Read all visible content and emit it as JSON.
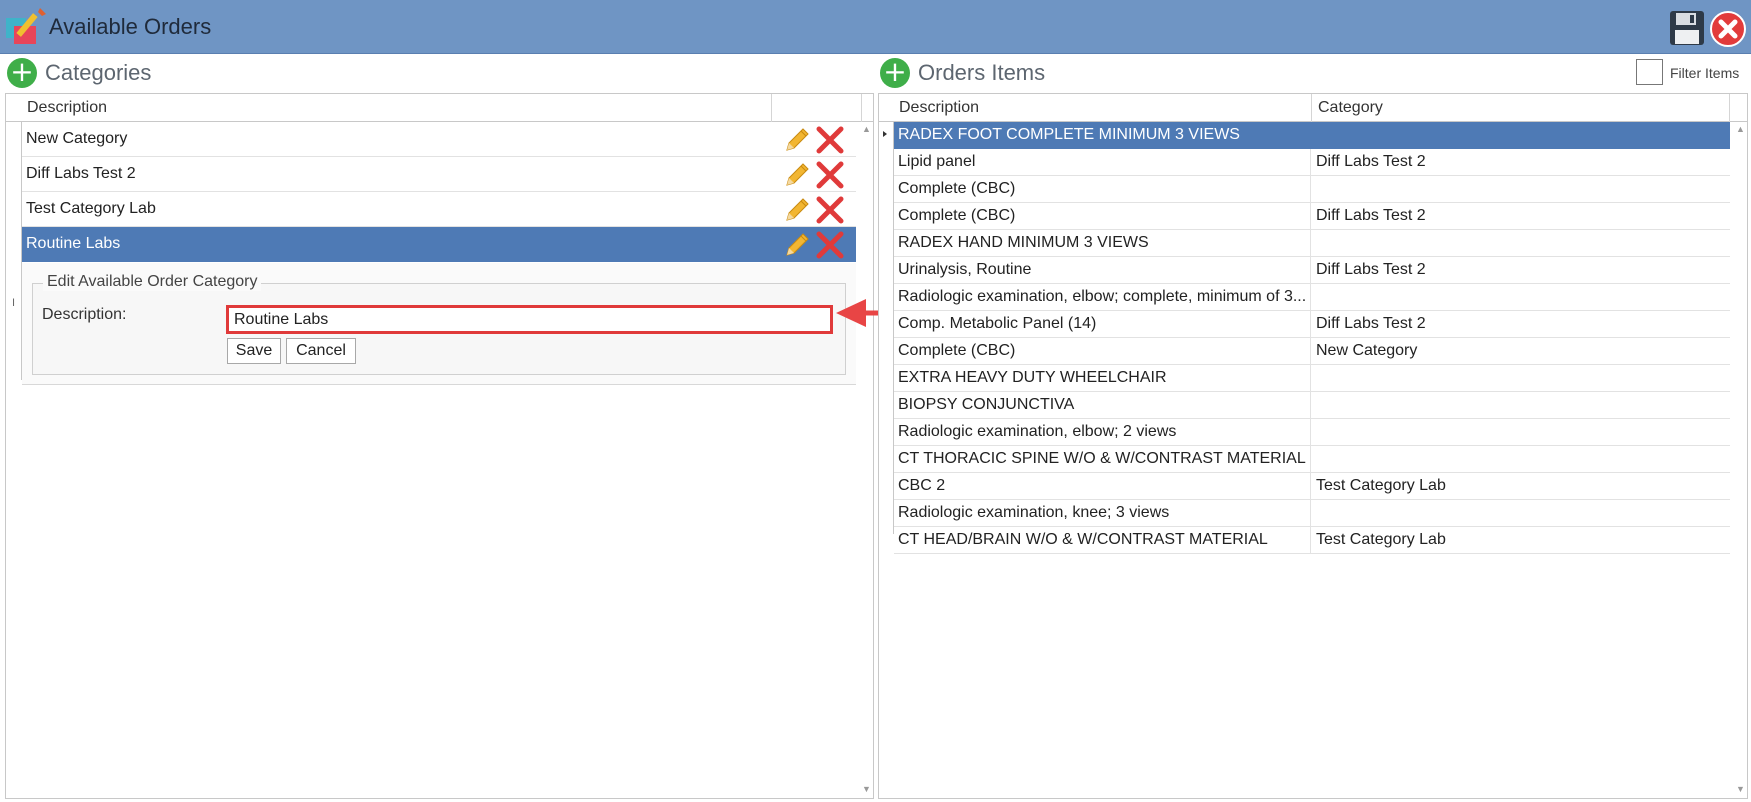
{
  "window": {
    "title": "Available Orders",
    "save_icon": "floppy-disk-icon",
    "close_icon": "red-close-icon",
    "app_icon": "pencil-order-icon"
  },
  "categories": {
    "title": "Categories",
    "columns": {
      "description": "Description"
    },
    "items": [
      {
        "label": "New Category"
      },
      {
        "label": "Diff Labs Test 2"
      },
      {
        "label": "Test Category Lab"
      },
      {
        "label": "Routine Labs",
        "selected": true
      }
    ],
    "edit": {
      "legend": "Edit Available Order Category",
      "description_label": "Description:",
      "description_value": "Routine Labs",
      "save_label": "Save",
      "cancel_label": "Cancel"
    }
  },
  "orders": {
    "title": "Orders Items",
    "filter_label": "Filter Items",
    "columns": {
      "description": "Description",
      "category": "Category"
    },
    "rows": [
      {
        "description": "RADEX FOOT COMPLETE MINIMUM 3 VIEWS",
        "category": "",
        "selected": true
      },
      {
        "description": "Lipid panel",
        "category": "Diff Labs Test 2"
      },
      {
        "description": "Complete (CBC)",
        "category": ""
      },
      {
        "description": "Complete (CBC)",
        "category": "Diff Labs Test 2"
      },
      {
        "description": "RADEX HAND MINIMUM 3 VIEWS",
        "category": ""
      },
      {
        "description": "Urinalysis, Routine",
        "category": "Diff Labs Test 2"
      },
      {
        "description": "Radiologic examination, elbow; complete, minimum of 3...",
        "category": ""
      },
      {
        "description": "Comp. Metabolic Panel (14)",
        "category": "Diff Labs Test 2"
      },
      {
        "description": "Complete (CBC)",
        "category": "New Category"
      },
      {
        "description": "EXTRA HEAVY DUTY WHEELCHAIR",
        "category": ""
      },
      {
        "description": "BIOPSY CONJUNCTIVA",
        "category": ""
      },
      {
        "description": "Radiologic examination, elbow; 2 views",
        "category": ""
      },
      {
        "description": "CT THORACIC SPINE W/O & W/CONTRAST MATERIAL",
        "category": ""
      },
      {
        "description": "CBC 2",
        "category": "Test Category Lab"
      },
      {
        "description": "Radiologic examination, knee; 3 views",
        "category": ""
      },
      {
        "description": "CT HEAD/BRAIN W/O & W/CONTRAST MATERIAL",
        "category": "Test Category Lab"
      }
    ]
  },
  "colors": {
    "titlebar": "#6f95c4",
    "selection": "#4e7ab5",
    "add_green": "#3fae49",
    "highlight_red": "#e03a3a"
  }
}
